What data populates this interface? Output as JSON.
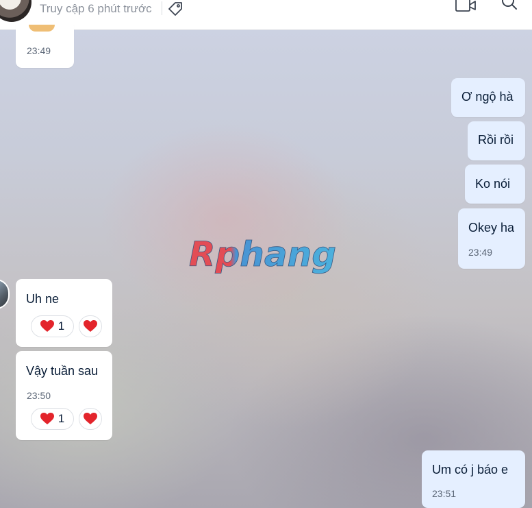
{
  "header": {
    "status": "Truy cập 6 phút trước",
    "icons": [
      "avatar",
      "tag-icon",
      "video-call-icon",
      "search-icon"
    ]
  },
  "messages": [
    {
      "side": "received",
      "time": "23:49"
    },
    {
      "side": "sent",
      "text": "Ơ ngộ hà"
    },
    {
      "side": "sent",
      "text": "Rồi rồi"
    },
    {
      "side": "sent",
      "text": "Ko nói"
    },
    {
      "side": "sent",
      "text": "Okey ha",
      "time": "23:49"
    },
    {
      "side": "received",
      "text": "Uh ne",
      "reaction_count": "1"
    },
    {
      "side": "received",
      "text": "Vậy tuần sau",
      "time": "23:50",
      "reaction_count": "1"
    },
    {
      "side": "sent",
      "text": "Um có j báo e",
      "time": "23:51"
    }
  ],
  "watermark": {
    "text": "Rphang"
  },
  "colors": {
    "sent_bubble": "#e5efff",
    "received_bubble": "#ffffff",
    "heart": "#e3242b"
  }
}
